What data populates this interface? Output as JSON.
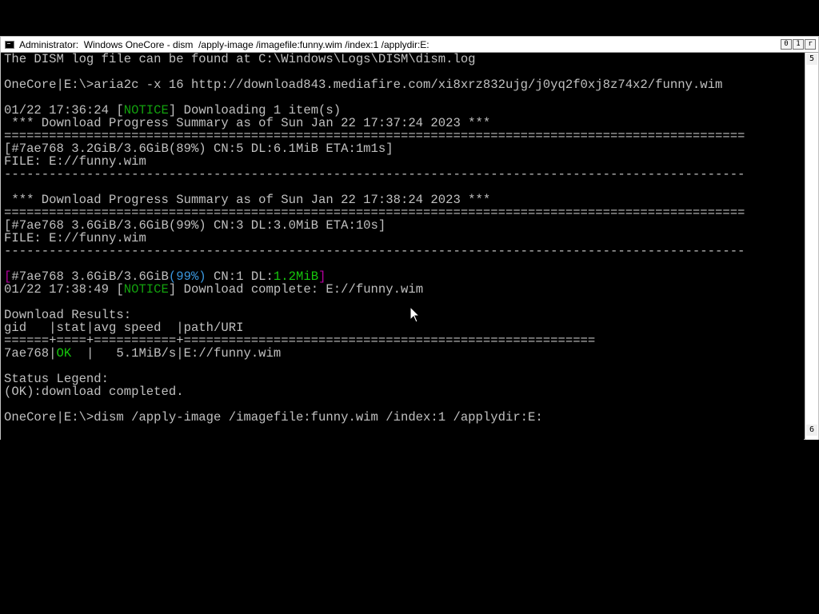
{
  "window": {
    "title": "Administrator:  Windows OneCore - dism  /apply-image /imagefile:funny.wim /index:1 /applydir:E:",
    "buttons": [
      "0",
      "1",
      "r"
    ]
  },
  "scrollbar": {
    "up_glyph": "5",
    "down_glyph": "6"
  },
  "colors": {
    "text": "#c0c0c0",
    "notice": "#13a10e",
    "ok": "#16c60c",
    "percent": "#3a96dd",
    "bracket": "#b4009e",
    "background": "#000000"
  },
  "console": {
    "l1": "The DISM log file can be found at C:\\Windows\\Logs\\DISM\\dism.log",
    "l2": "OneCore|E:\\>aria2c -x 16 http://download843.mediafire.com/xi8xrz832ujg/j0yq2f0xj8z74x2/funny.wim",
    "l3_pre": "01/22 17:36:24 [",
    "l3_notice": "NOTICE",
    "l3_post": "] Downloading 1 item(s)",
    "l4": " *** Download Progress Summary as of Sun Jan 22 17:37:24 2023 ***",
    "l5": "===================================================================================================",
    "l6": "[#7ae768 3.2GiB/3.6GiB(89%) CN:5 DL:6.1MiB ETA:1m1s]",
    "l7": "FILE: E://funny.wim",
    "l8": "---------------------------------------------------------------------------------------------------",
    "l9": " *** Download Progress Summary as of Sun Jan 22 17:38:24 2023 ***",
    "l10": "===================================================================================================",
    "l11": "[#7ae768 3.6GiB/3.6GiB(99%) CN:3 DL:3.0MiB ETA:10s]",
    "l12": "FILE: E://funny.wim",
    "l13": "---------------------------------------------------------------------------------------------------",
    "l14_open": "[",
    "l14_a": "#7ae768 3.6GiB/3.6GiB",
    "l14_pct": "(99%)",
    "l14_b": " CN:1 DL:",
    "l14_dl": "1.2MiB",
    "l14_close": "]",
    "l15_pre": "01/22 17:38:49 [",
    "l15_notice": "NOTICE",
    "l15_post": "] Download complete: E://funny.wim",
    "l16": "Download Results:",
    "l17": "gid   |stat|avg speed  |path/URI",
    "l18": "======+====+===========+=======================================================",
    "l19_a": "7ae768|",
    "l19_ok": "OK",
    "l19_b": "  |   5.1MiB/s|E://funny.wim",
    "l20": "Status Legend:",
    "l21": "(OK):download completed.",
    "l22": "OneCore|E:\\>dism /apply-image /imagefile:funny.wim /index:1 /applydir:E:"
  }
}
